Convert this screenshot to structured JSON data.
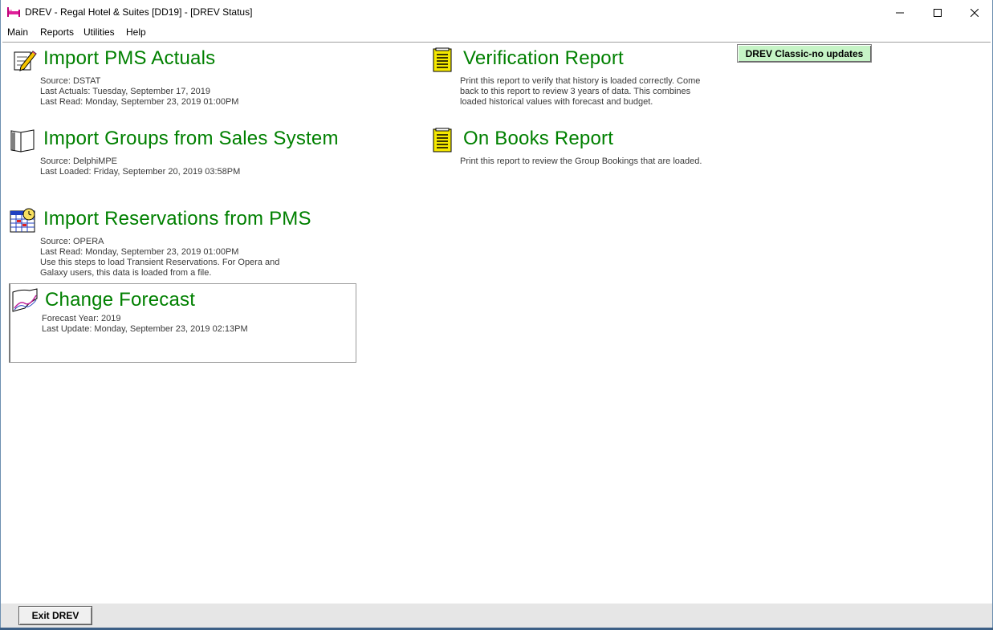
{
  "window": {
    "title": "DREV - Regal Hotel & Suites [DD19] - [DREV Status]",
    "controls": {
      "minimize": "minimize",
      "maximize": "maximize",
      "close": "close"
    }
  },
  "menubar": {
    "items": [
      {
        "label": "Main"
      },
      {
        "label": "Reports"
      },
      {
        "label": "Utilities"
      },
      {
        "label": "Help"
      }
    ]
  },
  "tasks": {
    "import_pms_actuals": {
      "title": "Import PMS Actuals",
      "icon": "pencil-checklist-icon",
      "lines": [
        "Source: DSTAT",
        "Last Actuals: Tuesday, September 17, 2019",
        "Last Read: Monday, September 23, 2019 01:00PM"
      ]
    },
    "import_groups": {
      "title": "Import Groups from Sales System",
      "icon": "open-book-icon",
      "lines": [
        "Source: DelphiMPE",
        "Last Loaded: Friday, September 20, 2019 03:58PM"
      ]
    },
    "import_reservations": {
      "title": "Import Reservations from PMS",
      "icon": "calendar-clock-icon",
      "lines": [
        "Source: OPERA",
        "Last Read: Monday, September 23, 2019 01:00PM",
        "Use this steps to load Transient Reservations.  For Opera and",
        "Galaxy users, this data is loaded from a file."
      ]
    },
    "change_forecast": {
      "title": "Change Forecast",
      "icon": "forecast-chart-icon",
      "lines": [
        "Forecast Year: 2019",
        "Last Update: Monday, September 23, 2019 02:13PM"
      ]
    },
    "verification_report": {
      "title": "Verification Report",
      "icon": "report-document-icon",
      "lines": [
        "Print this report to verify that history is loaded correctly.  Come",
        "back to this report to review 3 years of data.  This combines",
        "loaded historical values with forecast and budget."
      ]
    },
    "on_books_report": {
      "title": "On Books Report",
      "icon": "report-document-icon",
      "lines": [
        "Print this report to review the Group Bookings that are loaded."
      ]
    }
  },
  "classic_button": {
    "label": "DREV Classic-no updates"
  },
  "footer": {
    "exit_label": "Exit DREV"
  },
  "colors": {
    "title_green": "#008000",
    "classic_bg": "#c6f4c6",
    "footer_bg": "#e6e6e6"
  }
}
